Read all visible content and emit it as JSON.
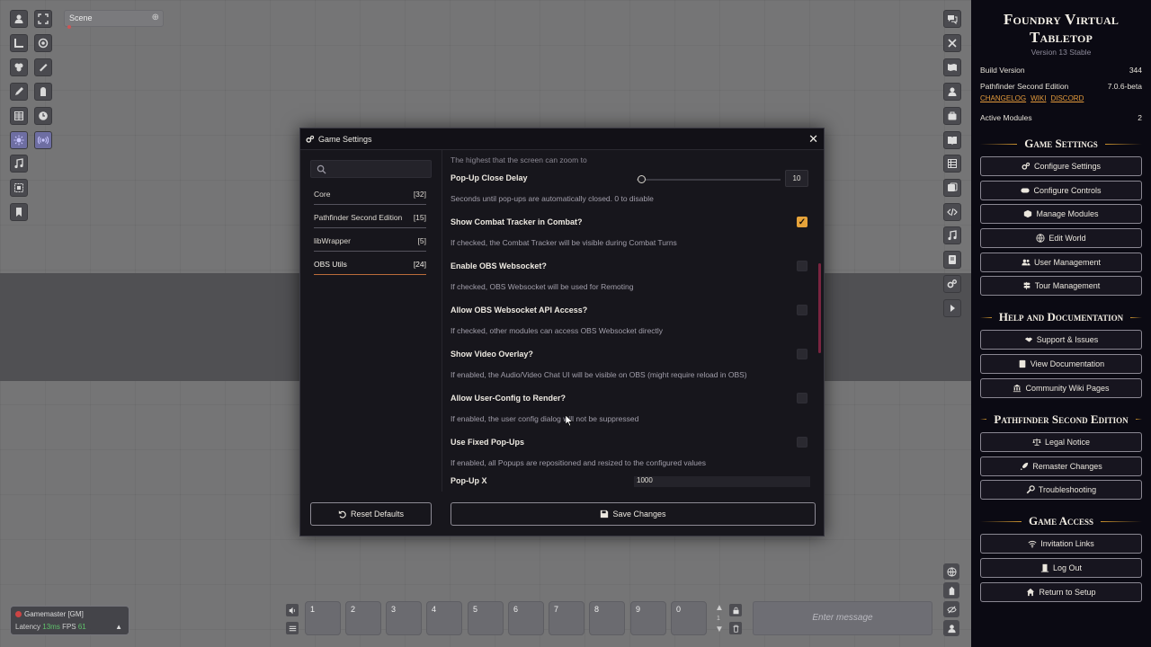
{
  "scene": {
    "label": "Scene"
  },
  "left_controls": [
    "token-icon",
    "select-icon",
    "ruler-icon",
    "ping-icon",
    "tiles-icon",
    "measure-icon",
    "draw-icon",
    "wall-icon",
    "grid-icon",
    "clock-icon",
    "light-icon",
    "sound-icon",
    "music-icon",
    "region-icon",
    "notes-icon"
  ],
  "right_rail_icons": [
    "chat-icon",
    "combat-icon",
    "scenes-icon",
    "actors-icon",
    "items-icon",
    "journal-icon",
    "tables-icon",
    "cards-icon",
    "macros-icon",
    "playlists-icon",
    "compendium-icon",
    "settings-icon",
    "collapse-icon"
  ],
  "sidebar": {
    "title": "Foundry Virtual Tabletop",
    "subtitle": "Version 13 Stable",
    "build_label": "Build Version",
    "build_value": "344",
    "system_label": "Pathfinder Second Edition",
    "system_value": "7.0.6-beta",
    "links": [
      "CHANGELOG",
      "WIKI",
      "DISCORD"
    ],
    "modules_label": "Active Modules",
    "modules_value": "2",
    "sections": [
      {
        "title": "Game Settings",
        "buttons": [
          {
            "label": "Configure Settings",
            "icon": "cogs-icon"
          },
          {
            "label": "Configure Controls",
            "icon": "gamepad-icon"
          },
          {
            "label": "Manage Modules",
            "icon": "cube-icon"
          },
          {
            "label": "Edit World",
            "icon": "globe-icon"
          },
          {
            "label": "User Management",
            "icon": "users-icon"
          },
          {
            "label": "Tour Management",
            "icon": "signpost-icon"
          }
        ]
      },
      {
        "title": "Help and Documentation",
        "buttons": [
          {
            "label": "Support & Issues",
            "icon": "handshake-icon"
          },
          {
            "label": "View Documentation",
            "icon": "book-icon"
          },
          {
            "label": "Community Wiki Pages",
            "icon": "landmark-icon"
          }
        ]
      },
      {
        "title": "Pathfinder Second Edition",
        "buttons": [
          {
            "label": "Legal Notice",
            "icon": "scale-icon"
          },
          {
            "label": "Remaster Changes",
            "icon": "rocket-icon"
          },
          {
            "label": "Troubleshooting",
            "icon": "wrench-icon"
          }
        ]
      },
      {
        "title": "Game Access",
        "buttons": [
          {
            "label": "Invitation Links",
            "icon": "wifi-icon"
          },
          {
            "label": "Log Out",
            "icon": "door-icon"
          },
          {
            "label": "Return to Setup",
            "icon": "home-icon"
          }
        ]
      }
    ]
  },
  "dialog": {
    "title": "Game Settings",
    "search_placeholder": "",
    "categories": [
      {
        "label": "Core",
        "count": "[32]"
      },
      {
        "label": "Pathfinder Second Edition",
        "count": "[15]"
      },
      {
        "label": "libWrapper",
        "count": "[5]"
      },
      {
        "label": "OBS Utils",
        "count": "[24]"
      }
    ],
    "partial_hint": "The highest that the screen can zoom to",
    "settings": [
      {
        "label": "Pop-Up Close Delay",
        "hint": "Seconds until pop-ups are automatically closed. 0 to disable",
        "control": "slider",
        "value": "10",
        "level": 0.0
      },
      {
        "label": "Show Combat Tracker in Combat?",
        "hint": "If checked, the Combat Tracker will be visible during Combat Turns",
        "control": "checkbox",
        "checked": true
      },
      {
        "label": "Enable OBS Websocket?",
        "hint": "If checked, OBS Websocket will be used for Remoting",
        "control": "checkbox",
        "checked": false
      },
      {
        "label": "Allow OBS Websocket API Access?",
        "hint": "If checked, other modules can access OBS Websocket directly",
        "control": "checkbox",
        "checked": false
      },
      {
        "label": "Show Video Overlay?",
        "hint": "If enabled, the Audio/Video Chat UI will be visible on OBS (might require reload in OBS)",
        "control": "checkbox",
        "checked": false
      },
      {
        "label": "Allow User-Config to Render?",
        "hint": "If enabled, the user config dialog will not be suppressed",
        "control": "checkbox",
        "checked": false
      },
      {
        "label": "Use Fixed Pop-Ups",
        "hint": "If enabled, all Popups are repositioned and resized to the configured values",
        "control": "checkbox",
        "checked": false
      }
    ],
    "popup_x": {
      "label": "Pop-Up X",
      "value": "1000"
    },
    "reset_label": "Reset Defaults",
    "save_label": "Save Changes",
    "accent": "#e6a33a"
  },
  "players": {
    "name": "Gamemaster [GM]",
    "latency_label": "Latency",
    "latency_value": "13ms",
    "fps_label": "FPS",
    "fps_value": "61"
  },
  "hotbar": {
    "slots": [
      "1",
      "2",
      "3",
      "4",
      "5",
      "6",
      "7",
      "8",
      "9",
      "0"
    ],
    "page": "1"
  },
  "chat": {
    "placeholder": "Enter message"
  }
}
